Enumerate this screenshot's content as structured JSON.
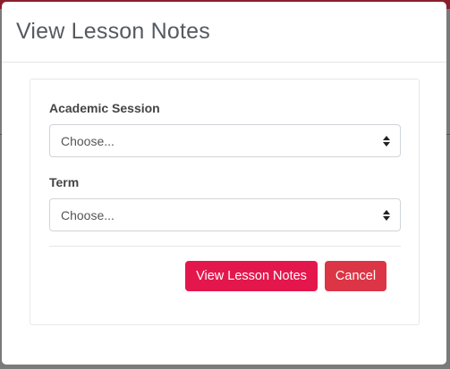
{
  "modal": {
    "title": "View Lesson Notes"
  },
  "form": {
    "session_label": "Academic Session",
    "session_value": "Choose...",
    "term_label": "Term",
    "term_value": "Choose..."
  },
  "actions": {
    "submit_label": "View Lesson Notes",
    "cancel_label": "Cancel"
  },
  "colors": {
    "primary": "#e4174d",
    "cancel": "#dc3545",
    "topbar": "#8b1e2c"
  },
  "icons": {
    "select_arrow": "sort-arrows-icon"
  }
}
